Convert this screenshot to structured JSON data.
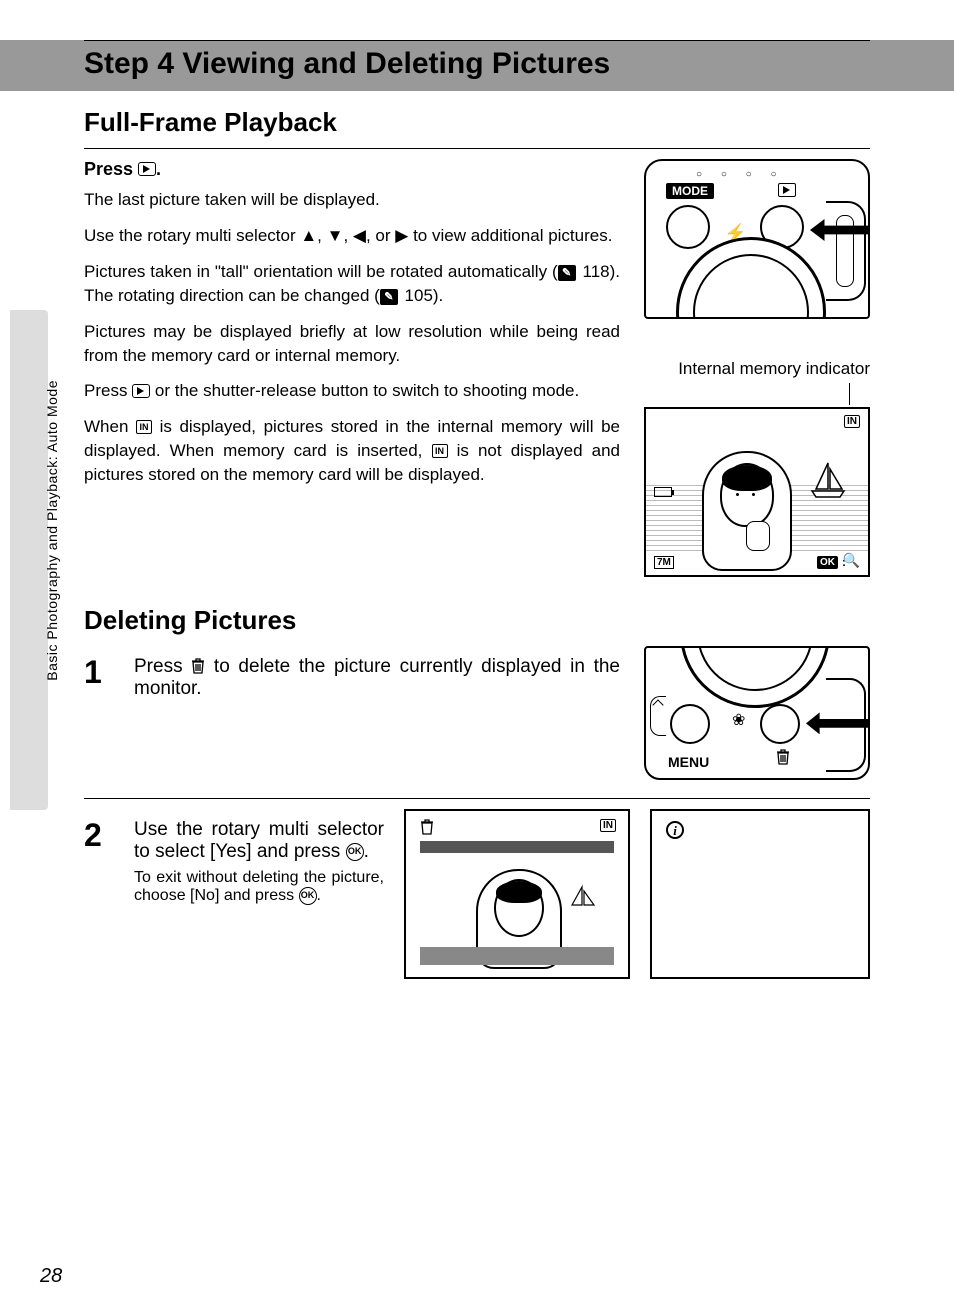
{
  "page_number": "28",
  "side_label": "Basic Photography and Playback: Auto Mode",
  "title": "Step 4 Viewing and Deleting Pictures",
  "section1": {
    "heading": "Full-Frame Playback",
    "instruction_prefix": "Press ",
    "instruction_suffix": ".",
    "p1": "The last picture taken will be displayed.",
    "p2a": "Use the rotary multi selector ",
    "p2b": " to view additional pictures.",
    "arrows_text": "▲, ▼, ◀, or ▶",
    "p3a": "Pictures taken in \"tall\" orientation will be rotated automatically (",
    "p3b": " 118). The rotating direction can be changed (",
    "p3c": " 105).",
    "p4": "Pictures may be displayed briefly at low resolution while being read from the memory card or internal memory.",
    "p5a": "Press ",
    "p5b": " or the shutter-release button to switch to shooting mode.",
    "p6a": "When ",
    "p6b": " is displayed, pictures stored in the internal memory will be displayed. When memory card is inserted, ",
    "p6c": " is not displayed and pictures stored on the memory card will be displayed.",
    "fig2_label": "Internal memory indicator",
    "camera_top": {
      "mode": "MODE"
    },
    "lcd": {
      "in": "IN",
      "size": "7M",
      "ok": "OK"
    }
  },
  "section2": {
    "heading": "Deleting Pictures",
    "step1_num": "1",
    "step1a": "Press ",
    "step1b": " to delete the picture currently displayed in the monitor.",
    "step2_num": "2",
    "step2a": "Use the rotary multi selector to select [Yes] and press ",
    "step2b": ".",
    "step2_sub_a": "To exit without deleting the picture, choose [No] and press ",
    "step2_sub_b": ".",
    "camera_bottom": {
      "menu": "MENU"
    },
    "mini_lcd": {
      "in": "IN"
    },
    "info_icon": "i"
  }
}
